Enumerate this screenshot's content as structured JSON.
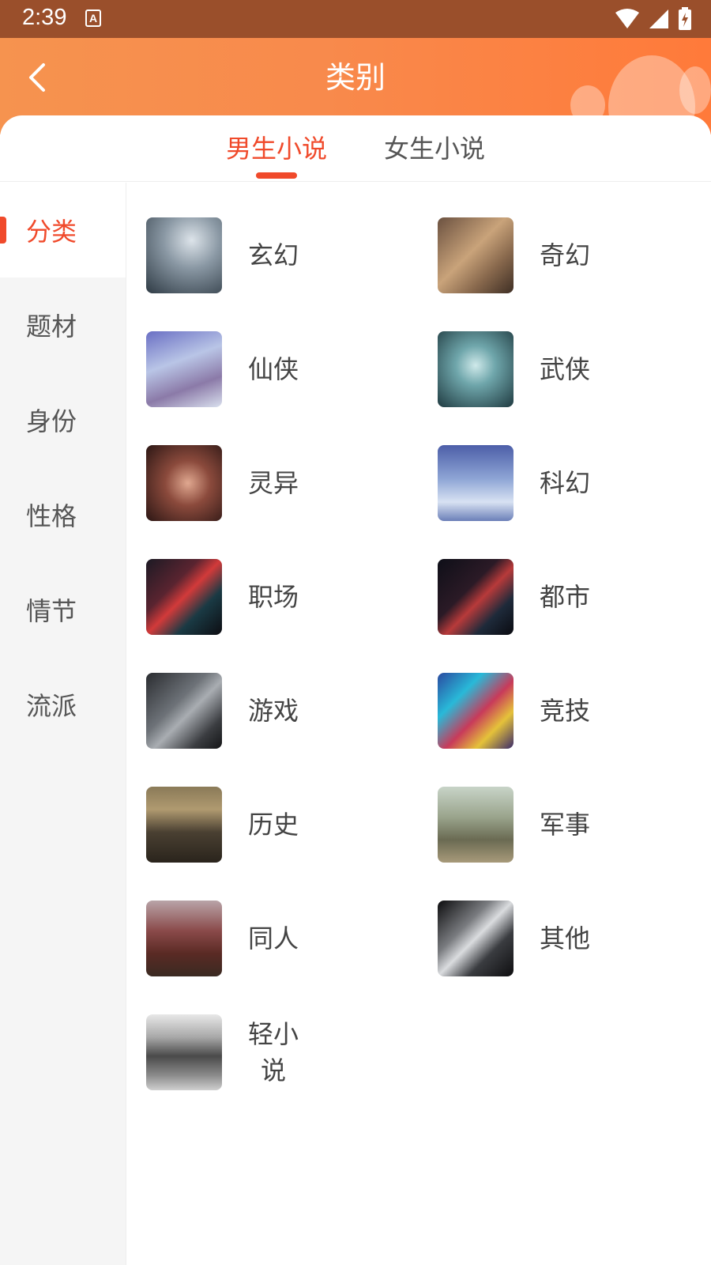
{
  "status_bar": {
    "time": "2:39",
    "notification_icon": "a-icon",
    "icons": [
      "wifi-icon",
      "signal-icon",
      "battery-icon"
    ]
  },
  "header": {
    "title": "类别",
    "back_icon": "chevron-left-icon"
  },
  "tabs": [
    {
      "label": "男生小说",
      "active": true
    },
    {
      "label": "女生小说",
      "active": false
    }
  ],
  "sidebar": {
    "items": [
      {
        "label": "分类",
        "active": true
      },
      {
        "label": "题材",
        "active": false
      },
      {
        "label": "身份",
        "active": false
      },
      {
        "label": "性格",
        "active": false
      },
      {
        "label": "情节",
        "active": false
      },
      {
        "label": "流派",
        "active": false
      }
    ]
  },
  "categories": [
    {
      "label": "玄幻"
    },
    {
      "label": "奇幻"
    },
    {
      "label": "仙侠"
    },
    {
      "label": "武侠"
    },
    {
      "label": "灵异"
    },
    {
      "label": "科幻"
    },
    {
      "label": "职场"
    },
    {
      "label": "都市"
    },
    {
      "label": "游戏"
    },
    {
      "label": "竞技"
    },
    {
      "label": "历史"
    },
    {
      "label": "军事"
    },
    {
      "label": "同人"
    },
    {
      "label": "其他"
    },
    {
      "label": "轻小说"
    }
  ],
  "colors": {
    "accent": "#f04a2b",
    "header_start": "#f6934f",
    "header_end": "#ff7a3a",
    "status_bar": "#9a4f2b",
    "sidebar_bg": "#f5f5f5"
  }
}
